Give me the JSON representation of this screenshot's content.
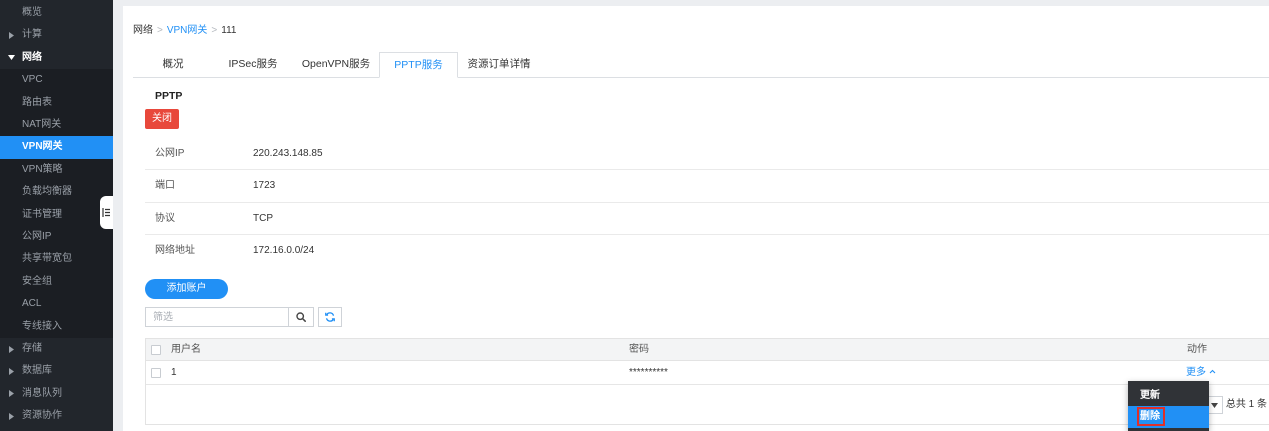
{
  "sidebar": {
    "items": [
      {
        "label": "概览"
      },
      {
        "label": "计算",
        "icon": "caret-right-icon",
        "expanded": false
      },
      {
        "label": "网络",
        "icon": "caret-down-icon",
        "expanded": true
      },
      {
        "label": "VPC",
        "child": true
      },
      {
        "label": "路由表",
        "child": true
      },
      {
        "label": "NAT网关",
        "child": true
      },
      {
        "label": "VPN网关",
        "child": true,
        "active": true
      },
      {
        "label": "VPN策略",
        "child": true
      },
      {
        "label": "负载均衡器",
        "child": true
      },
      {
        "label": "证书管理",
        "child": true
      },
      {
        "label": "公网IP",
        "child": true
      },
      {
        "label": "共享带宽包",
        "child": true
      },
      {
        "label": "安全组",
        "child": true
      },
      {
        "label": "ACL",
        "child": true
      },
      {
        "label": "专线接入",
        "child": true
      },
      {
        "label": "存储",
        "icon": "caret-right-icon",
        "expanded": false
      },
      {
        "label": "数据库",
        "icon": "caret-right-icon",
        "expanded": false
      },
      {
        "label": "消息队列",
        "icon": "caret-right-icon",
        "expanded": false
      },
      {
        "label": "资源协作",
        "icon": "caret-right-icon",
        "expanded": false
      }
    ],
    "collapse_toggle_icon": "sidebar-collapse-icon"
  },
  "breadcrumb": {
    "separator": ">",
    "items": [
      "网络",
      "VPN网关",
      "111"
    ]
  },
  "tabs": {
    "items": [
      "概况",
      "IPSec服务",
      "OpenVPN服务",
      "PPTP服务",
      "资源订单详情"
    ],
    "active_index": 3
  },
  "pptp": {
    "title": "PPTP",
    "close_label": "关闭",
    "info": [
      {
        "label": "公网IP",
        "value": "220.243.148.85"
      },
      {
        "label": "端口",
        "value": "1723"
      },
      {
        "label": "协议",
        "value": "TCP"
      },
      {
        "label": "网络地址",
        "value": "172.16.0.0/24"
      }
    ]
  },
  "accounts": {
    "add_label": "添加账户",
    "filter": {
      "placeholder": "筛选",
      "value": ""
    },
    "search_icon": "search-icon",
    "refresh_icon": "refresh-icon",
    "table": {
      "select_all": false,
      "columns": {
        "username": "用户名",
        "password": "密码",
        "action": "动作"
      },
      "rows": [
        {
          "selected": false,
          "username": "1",
          "password": "**********",
          "action_label": "更多",
          "action_icon": "chevron-up-icon"
        }
      ]
    },
    "pagination": {
      "total_label": "总共 1 条",
      "page_size_icon": "caret-down-icon"
    }
  },
  "action_menu": {
    "items": [
      {
        "label": "更新",
        "highlighted": false
      },
      {
        "label": "删除",
        "highlighted": true,
        "outlined": true
      }
    ]
  },
  "colors": {
    "sidebar_bg": "#22262c",
    "accent": "#2190f5",
    "danger": "#e8483b",
    "outline": "#e0302a",
    "menu_bg": "#303337"
  }
}
